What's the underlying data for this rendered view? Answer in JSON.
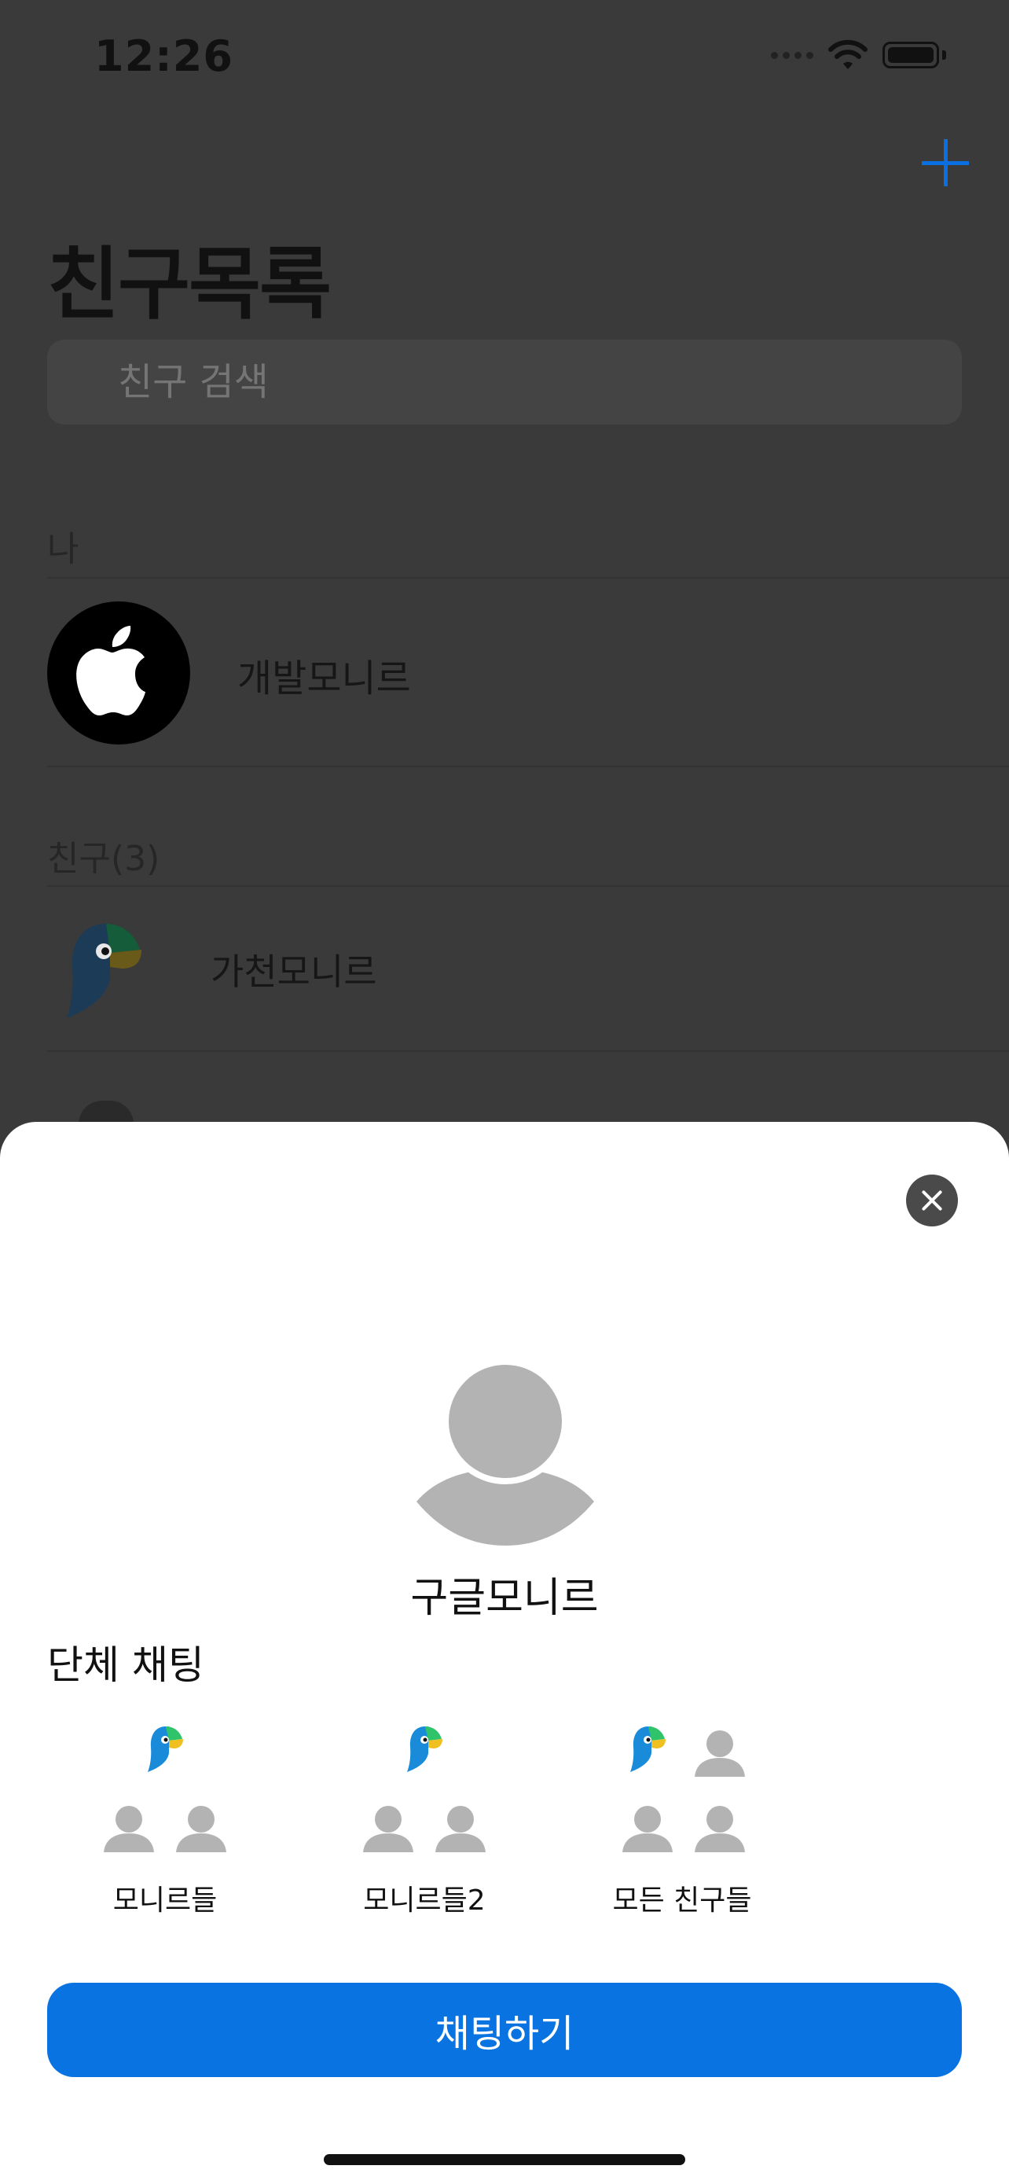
{
  "status_bar": {
    "time": "12:26"
  },
  "header": {
    "title": "친구목록",
    "add_icon": "plus-icon"
  },
  "search": {
    "placeholder": "친구 검색"
  },
  "sections": {
    "me": {
      "label": "나",
      "name": "개발모니르",
      "avatar_icon": "apple-logo-icon"
    },
    "friends": {
      "label": "친구(3)",
      "items": [
        {
          "name": "가천모니르",
          "avatar_icon": "parrot-logo-icon"
        }
      ]
    }
  },
  "sheet": {
    "close_icon": "close-icon",
    "profile": {
      "name": "구글모니르",
      "avatar_icon": "person-silhouette-icon"
    },
    "group_chat": {
      "title": "단체 채팅",
      "groups": [
        {
          "label": "모니르들"
        },
        {
          "label": "모니르들2"
        },
        {
          "label": "모든 친구들"
        }
      ]
    },
    "chat_button": "채팅하기"
  },
  "colors": {
    "accent": "#0a73e2",
    "placeholder_gray": "#b3b3b3",
    "dim_overlay": "#3a3a3a"
  }
}
